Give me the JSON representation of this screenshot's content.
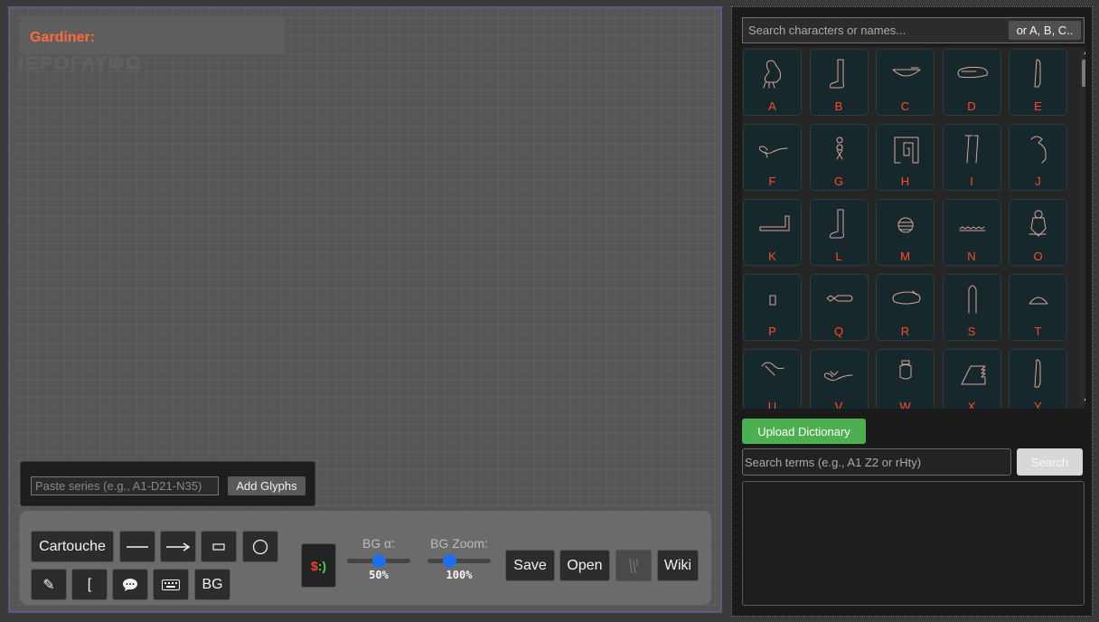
{
  "canvas": {
    "gardiner_label": "Gardiner:",
    "greek_title": "ΙΕΡΟΓΛΥΦΩ"
  },
  "paste_bar": {
    "placeholder": "Paste series (e.g., A1-D21-N35)",
    "add_label": "Add Glyphs"
  },
  "toolbar": {
    "cartouche": "Cartouche",
    "bracket": "[",
    "bg": "BG",
    "bg_alpha_label": "BG α:",
    "bg_alpha_value": "50%",
    "bg_alpha_level": 0.5,
    "bg_zoom_label": "BG Zoom:",
    "bg_zoom_value": "100%",
    "bg_zoom_level": 0.35,
    "save": "Save",
    "open": "Open",
    "wiki": "Wiki",
    "face_badge": "$:)"
  },
  "right_panel": {
    "search_placeholder": "Search characters or names...",
    "alpha_button": "or A, B, C..",
    "glyph_letters": [
      "A",
      "B",
      "C",
      "D",
      "E",
      "F",
      "G",
      "H",
      "I",
      "J",
      "K",
      "L",
      "M",
      "N",
      "O",
      "P",
      "Q",
      "R",
      "S",
      "T",
      "U",
      "V",
      "W",
      "X",
      "Y"
    ],
    "upload_label": "Upload Dictionary",
    "dict_placeholder": "Search terms (e.g., A1 Z2 or rHty)",
    "dict_search_label": "Search"
  },
  "colors": {
    "accent_red": "#ff4a2a",
    "upload_green": "#4caf50",
    "slider_blue": "#1e6ff0",
    "canvas_border": "#5d5a86"
  }
}
